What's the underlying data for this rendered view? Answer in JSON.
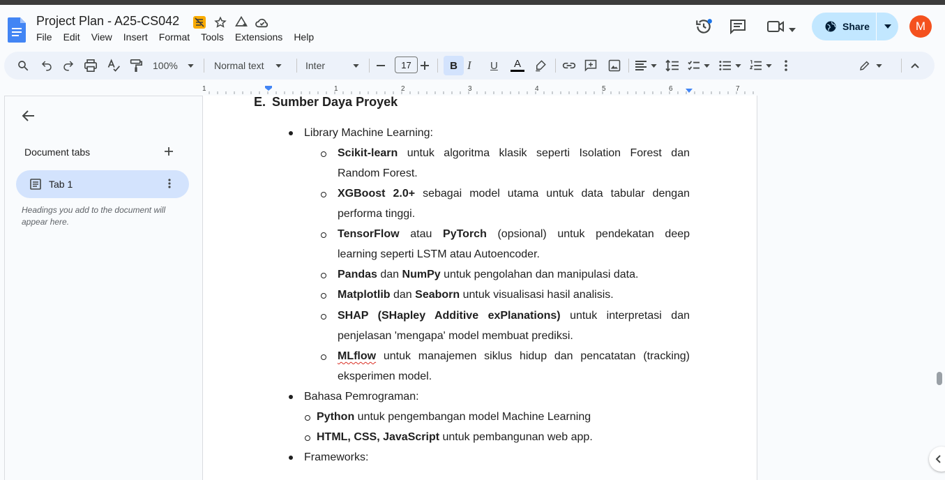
{
  "document": {
    "title": "Project Plan - A25-CS042"
  },
  "menu": [
    "File",
    "Edit",
    "View",
    "Insert",
    "Format",
    "Tools",
    "Extensions",
    "Help"
  ],
  "share": {
    "label": "Share"
  },
  "avatar": {
    "initial": "M",
    "color": "#f4511e"
  },
  "toolbar": {
    "zoom": "100%",
    "style": "Normal text",
    "font": "Inter",
    "font_size": "17",
    "bold_label": "B",
    "italic_label": "I",
    "underline_label": "U",
    "text_color_label": "A"
  },
  "ruler": {
    "labels": [
      "1",
      "1",
      "2",
      "3",
      "4",
      "5",
      "6",
      "7"
    ]
  },
  "sidebar": {
    "doc_tabs_title": "Document tabs",
    "tab_label": "Tab 1",
    "headings_note": "Headings you add to the document will appear here."
  },
  "content": {
    "heading_label": "E.",
    "heading_text": "Sumber Daya Proyek",
    "l1_ml": "Library Machine Learning:",
    "items": {
      "sk_b": "Scikit-learn",
      "sk_t1": " untuk algoritma klasik seperti Isolation Forest dan",
      "sk_t2": "Random Forest.",
      "xg_b": "XGBoost 2.0+",
      "xg_t1": " sebagai model utama untuk data tabular dengan",
      "xg_t2": "performa tinggi.",
      "tf_b1": "TensorFlow",
      "tf_t1": " atau ",
      "tf_b2": "PyTorch",
      "tf_t2": " (opsional) untuk pendekatan deep",
      "tf_t3": "learning seperti LSTM atau Autoencoder.",
      "pd_b1": "Pandas",
      "pd_t1": " dan ",
      "pd_b2": "NumPy",
      "pd_t2": " untuk pengolahan dan manipulasi data.",
      "mp_b1": "Matplotlib",
      "mp_t1": " dan ",
      "mp_b2": "Seaborn",
      "mp_t2": " untuk visualisasi hasil analisis.",
      "sh_b": "SHAP (SHapley Additive exPlanations)",
      "sh_t1": " untuk interpretasi dan",
      "sh_t2": "penjelasan 'mengapa' model membuat prediksi.",
      "mf_b": "MLflow",
      "mf_t1": " untuk manajemen siklus hidup dan pencatatan (tracking)",
      "mf_t2": "eksperimen model."
    },
    "l1_bp": "Bahasa Pemrograman:",
    "py_b": "Python",
    "py_t": " untuk pengembangan model Machine Learning",
    "web_b": "HTML, CSS, JavaScript",
    "web_t": " untuk pembangunan web app.",
    "l1_fw": "Frameworks:"
  }
}
